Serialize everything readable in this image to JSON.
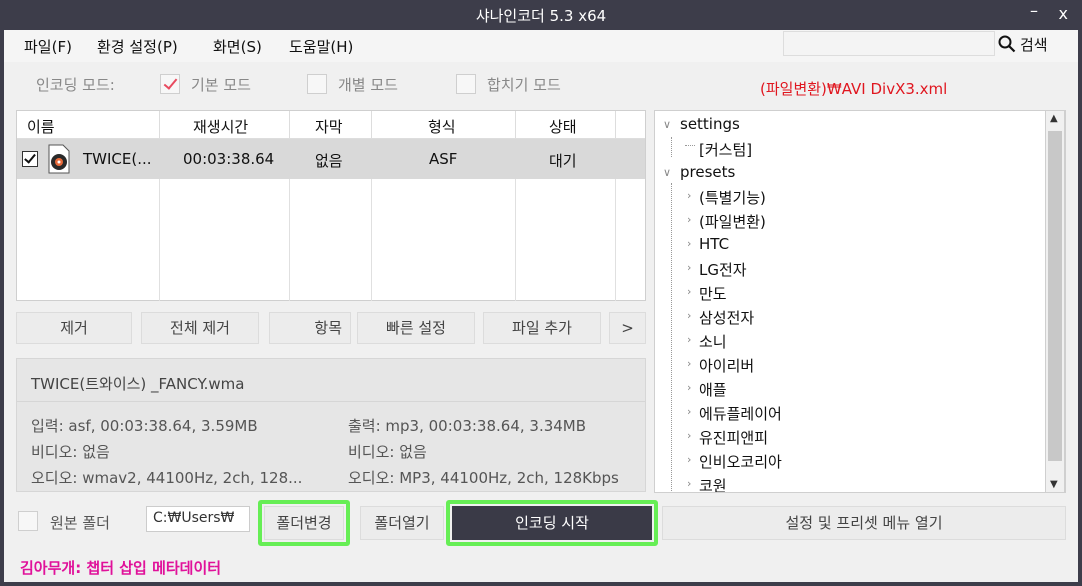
{
  "window": {
    "title": "샤나인코더  5.3  x64",
    "min_symbol": "–",
    "close_symbol": "x"
  },
  "menu": {
    "file": "파일(F)",
    "settings": "환경 설정(P)",
    "view": "화면(S)",
    "help": "도움말(H)"
  },
  "search": {
    "label": "검색",
    "value": ""
  },
  "encoding_mode": {
    "label": "인코딩 모드:",
    "basic": {
      "label": "기본 모드",
      "checked": true
    },
    "individual": {
      "label": "개별 모드",
      "checked": false
    },
    "merge": {
      "label": "합치기 모드",
      "checked": false
    }
  },
  "preset_path": "(파일변환)₩AVI DivX3.xml",
  "file_list": {
    "columns": [
      "이름",
      "재생시간",
      "자막",
      "형식",
      "상태"
    ],
    "rows": [
      {
        "checked": true,
        "name": "TWICE(...",
        "duration": "00:03:38.64",
        "subtitle": "없음",
        "format": "ASF",
        "status": "대기"
      }
    ]
  },
  "buttons": {
    "remove": "제거",
    "remove_all": "전체 제거",
    "items": "항목",
    "quick_settings": "빠른 설정",
    "add_file": "파일 추가",
    "more": ">"
  },
  "info": {
    "filename": "TWICE(트와이스) _FANCY.wma",
    "input": "입력: asf, 00:03:38.64, 3.59MB",
    "input_video": "비디오: 없음",
    "input_audio": "오디오: wmav2, 44100Hz, 2ch, 128...",
    "output": "출력: mp3, 00:03:38.64, 3.34MB",
    "output_video": "비디오: 없음",
    "output_audio": "오디오: MP3, 44100Hz, 2ch, 128Kbps"
  },
  "tree": {
    "settings": "settings",
    "custom": "[커스텀]",
    "presets": "presets",
    "items": [
      "(특별기능)",
      "(파일변환)",
      "HTC",
      "LG전자",
      "만도",
      "삼성전자",
      "소니",
      "아이리버",
      "애플",
      "에듀플레이어",
      "유진피앤피",
      "인비오코리아",
      "코원"
    ]
  },
  "bottom": {
    "original_folder": "원본 폴더",
    "output_path": "C:₩Users₩",
    "change_folder": "폴더변경",
    "open_folder": "폴더열기",
    "start_encoding": "인코딩 시작",
    "open_settings_menu": "설정 및 프리셋 메뉴 열기"
  },
  "status_text": "김아무개: 챕터 삽입 메타데이터",
  "colors": {
    "highlight": "#66ee55",
    "status_text": "#e0119a",
    "preset_path": "#e0161f",
    "titlebar": "#3d3d4a"
  }
}
